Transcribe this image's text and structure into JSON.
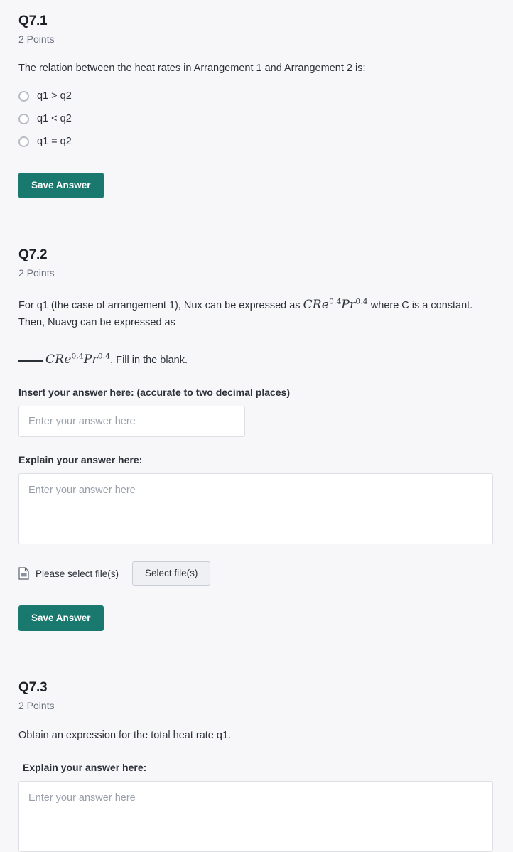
{
  "theme": {
    "page_background": "#f7f7fa",
    "accent_button": "#19796f",
    "text_primary": "#2c3138",
    "text_muted": "#6b7280",
    "input_border": "#dcdfe4"
  },
  "questions": [
    {
      "id": "q7-1",
      "title": "Q7.1",
      "points": "2 Points",
      "prompt": "The relation between the heat rates in Arrangement 1 and Arrangement 2 is:",
      "options": [
        {
          "label": "q1 > q2"
        },
        {
          "label": "q1 < q2"
        },
        {
          "label": "q1 = q2"
        }
      ],
      "save_label": "Save Answer"
    },
    {
      "id": "q7-2",
      "title": "Q7.2",
      "points": "2 Points",
      "prompt_part1": "For q1 (the case of arrangement 1), Nux can be expressed as",
      "math_inline": "C Re 0.4 Pr 0.4",
      "prompt_part2": "where C is a constant. Then, Nuavg can be expressed as",
      "fill_blank_suffix": ". Fill in the blank.",
      "math_blank": "C Re 0.4 Pr 0.4",
      "math_tokens": {
        "c": "C",
        "re": "Re",
        "re_exp": "0.4",
        "pr": "Pr",
        "pr_exp": "0.4"
      },
      "answer_label": "Insert your answer here: (accurate to two decimal places)",
      "answer_placeholder": "Enter your answer here",
      "answer_value": "",
      "explain_label": "Explain your answer here:",
      "explain_placeholder": "Enter your answer here",
      "explain_value": "",
      "file_icon": "document-icon",
      "file_status": "Please select file(s)",
      "file_button": "Select file(s)",
      "save_label": "Save Answer"
    },
    {
      "id": "q7-3",
      "title": "Q7.3",
      "points": "2 Points",
      "prompt": "Obtain an expression for the total heat rate q1.",
      "explain_label": "Explain your answer here:",
      "explain_placeholder": "Enter your answer here",
      "explain_value": ""
    }
  ]
}
